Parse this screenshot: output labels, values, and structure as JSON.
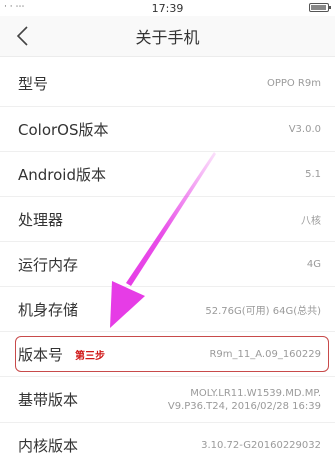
{
  "status_bar": {
    "time": "17:39",
    "left_icons": "· · ⋯",
    "battery_level": 0.95
  },
  "header": {
    "title": "关于手机"
  },
  "rows": [
    {
      "label": "型号",
      "value": "OPPO R9m"
    },
    {
      "label": "ColorOS版本",
      "value": "V3.0.0"
    },
    {
      "label": "Android版本",
      "value": "5.1"
    },
    {
      "label": "处理器",
      "value": "八核"
    },
    {
      "label": "运行内存",
      "value": "4G"
    },
    {
      "label": "机身存储",
      "value": "52.76G(可用)   64G(总共)"
    },
    {
      "label": "版本号",
      "value": "R9m_11_A.09_160229",
      "note": "第三步"
    },
    {
      "label": "基带版本",
      "value_line1": "MOLY.LR11.W1539.MD.MP.",
      "value_line2": "V9.P36.T24, 2016/02/28 16:39"
    },
    {
      "label": "内核版本",
      "value": "3.10.72-G20160229032"
    }
  ],
  "colors": {
    "highlight_border": "#c84a4a",
    "note_text": "#d01818",
    "arrow": "#e63ce6"
  }
}
